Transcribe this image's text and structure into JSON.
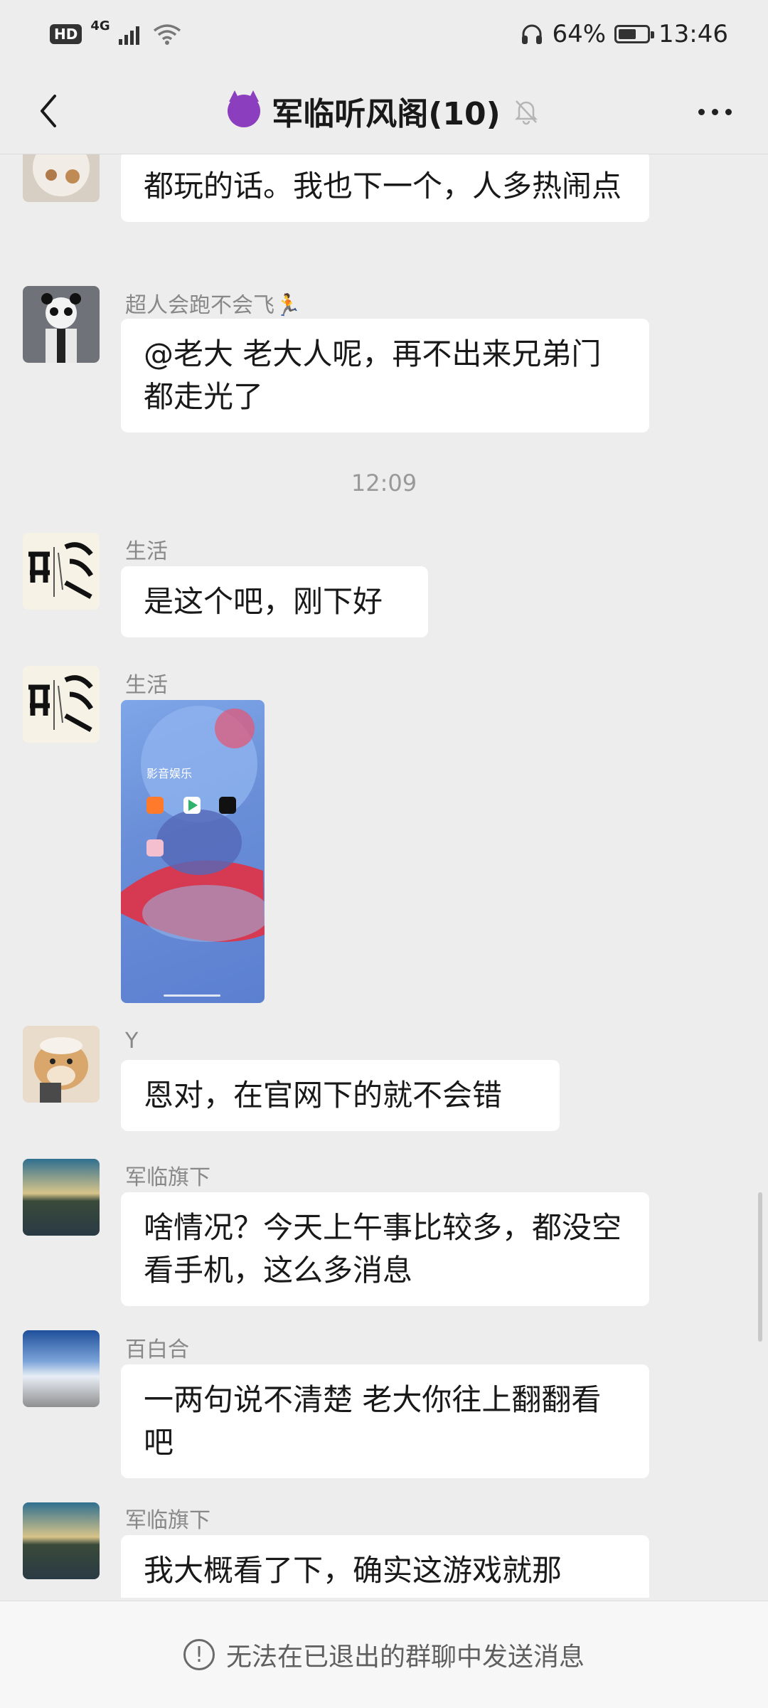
{
  "status_bar": {
    "network_badge": "HD",
    "network_type": "4G",
    "battery": "64%",
    "battery_level": 0.64,
    "time": "13:46"
  },
  "header": {
    "title": "军临听风阁(10)"
  },
  "messages": [
    {
      "sender": "",
      "text": "都玩的话。我也下一个，人多热闹点"
    },
    {
      "sender": "超人会跑不会飞🏃",
      "text": "@老大  老大人呢，再不出来兄弟门都走光了"
    },
    {
      "time": "12:09"
    },
    {
      "sender": "生活",
      "text": "是这个吧，刚下好"
    },
    {
      "sender": "生活",
      "image_text": "影音娱乐"
    },
    {
      "sender": "Y",
      "text": "恩对，在官网下的就不会错"
    },
    {
      "sender": "军临旗下",
      "text": "啥情况？今天上午事比较多，都没空看手机，这么多消息"
    },
    {
      "sender": "百白合",
      "text": "一两句说不清楚 老大你往上翻翻看吧"
    },
    {
      "sender": "军临旗下",
      "text": "我大概看了下，确实这游戏就那"
    }
  ],
  "footer": {
    "notice": "无法在已退出的群聊中发送消息"
  },
  "colors": {
    "background": "#ededed",
    "bubble": "#ffffff",
    "muted_text": "#888888"
  }
}
